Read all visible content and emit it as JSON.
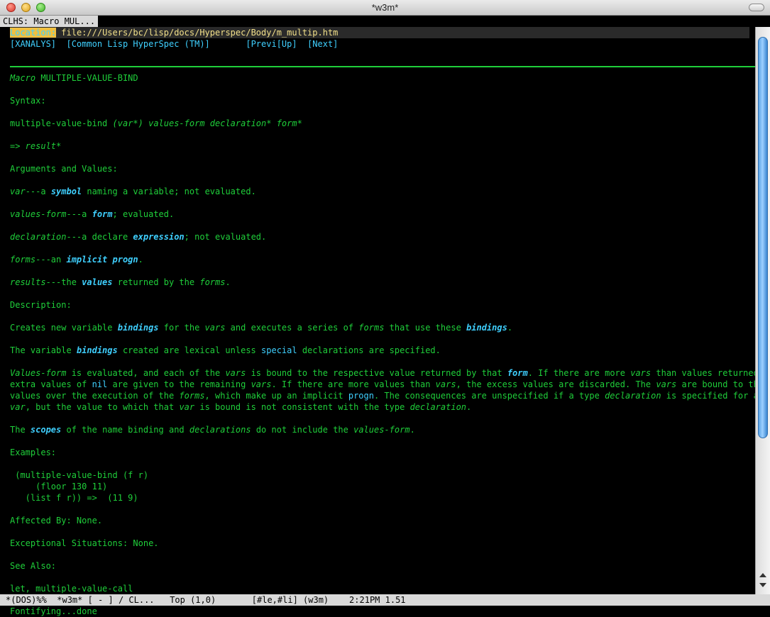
{
  "window": {
    "title": "*w3m*"
  },
  "tab": {
    "label": "CLHS: Macro MUL..."
  },
  "location": {
    "label": "Location:",
    "url": "file:///Users/bc/lisp/docs/Hyperspec/Body/m_multip.htm"
  },
  "nav": {
    "xanalys": "[XANALYS]",
    "hyperspec": "[Common Lisp HyperSpec (TM)]",
    "prev": "[Previ[Up]",
    "next": "[Next]"
  },
  "doc": {
    "heading_kind": "Macro",
    "heading_name": "MULTIPLE-VALUE-BIND",
    "syntax_label": "Syntax:",
    "syntax_name": "multiple-value-bind",
    "syntax_args": "(var*) values-form declaration* form*",
    "syntax_result": "=> result*",
    "args_label": "Arguments and Values:",
    "arg1": {
      "term": "var",
      "sep": "---a ",
      "link": "symbol",
      "rest": " naming a variable; not evaluated."
    },
    "arg2": {
      "term": "values-form",
      "sep": "---a ",
      "link": "form",
      "rest": "; evaluated."
    },
    "arg3": {
      "term": "declaration",
      "sep": "---a declare ",
      "link": "expression",
      "rest": "; not evaluated."
    },
    "arg4": {
      "term": "forms",
      "sep": "---an ",
      "link": "implicit progn",
      "rest": "."
    },
    "arg5": {
      "term": "results",
      "sep": "---the ",
      "link": "values",
      "mid": " returned by the ",
      "term2": "forms",
      "rest": "."
    },
    "description_label": "Description:",
    "desc1": {
      "a": "Creates new variable ",
      "link1": "bindings",
      "b": " for the ",
      "c": "vars",
      "d": " and executes a series of ",
      "e": "forms",
      "f": " that use these ",
      "link2": "bindings",
      "g": "."
    },
    "desc2": {
      "a": "The variable ",
      "link1": "bindings",
      "b": " created are lexical unless ",
      "link2": "special",
      "c": " declarations are specified."
    },
    "desc3_l1": {
      "a": "Values-form",
      "b": " is evaluated, and each of the ",
      "c": "vars",
      "d": " is bound to the respective value returned by that ",
      "link": "form",
      "e": ". If there are more ",
      "f": "vars",
      "g": " than values returned,"
    },
    "desc3_l2": {
      "a": "extra values of ",
      "link": "nil",
      "b": " are given to the remaining ",
      "c": "vars",
      "d": ". If there are more values than ",
      "e": "vars",
      "f": ", the excess values are discarded. The ",
      "g": "vars",
      "h": " are bound to the"
    },
    "desc3_l3": {
      "a": "values over the execution of the ",
      "b": "forms",
      "c": ", which make up an implicit ",
      "link": "progn",
      "d": ". The consequences are unspecified if a type ",
      "e": "declaration",
      "f": " is specified for a"
    },
    "desc3_l4": {
      "a": "var",
      "b": ", but the value to which that ",
      "c": "var",
      "d": " is bound is not consistent with the type ",
      "e": "declaration",
      "f": "."
    },
    "desc4": {
      "a": "The ",
      "link": "scopes",
      "b": " of the name binding and ",
      "c": "declarations",
      "d": " do not include the ",
      "e": "values-form",
      "f": "."
    },
    "examples_label": "Examples:",
    "code1": " (multiple-value-bind (f r)",
    "code2": "     (floor 130 11)",
    "code3": "   (list f r)) =>  (11 9)",
    "affected": "Affected By: None.",
    "exceptional": "Exceptional Situations: None.",
    "see_also": "See Also:",
    "see_also_links": "let, multiple-value-call"
  },
  "modeline": {
    "text": "*(DOS)%%  *w3m* [ - ] / CL...   Top (1,0)       [#le,#li] (w3m)    2:21PM 1.51"
  },
  "echo": {
    "text": "Fontifying...done"
  }
}
